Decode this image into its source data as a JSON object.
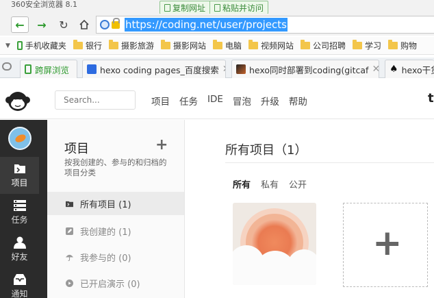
{
  "window": {
    "title": "360安全浏览器 8.1"
  },
  "clipboard": {
    "copy_url": "复制网址",
    "paste_visit": "粘贴并访问"
  },
  "address": {
    "url": "https://coding.net/user/projects"
  },
  "bookmarks": [
    {
      "label": "手机收藏夹",
      "icon": "phone-icon"
    },
    {
      "label": "银行",
      "icon": "folder-icon"
    },
    {
      "label": "摄影旅游",
      "icon": "folder-icon"
    },
    {
      "label": "摄影网站",
      "icon": "folder-icon"
    },
    {
      "label": "电脑",
      "icon": "folder-icon"
    },
    {
      "label": "视频网站",
      "icon": "folder-icon"
    },
    {
      "label": "公司招聘",
      "icon": "folder-icon"
    },
    {
      "label": "学习",
      "icon": "folder-icon"
    },
    {
      "label": "购物",
      "icon": "folder-icon"
    }
  ],
  "tabs": [
    {
      "label": "跨屏浏览"
    },
    {
      "label": "hexo coding pages_百度搜索"
    },
    {
      "label": "hexo同时部署到coding(gitcaf"
    },
    {
      "label": "hexo干货"
    }
  ],
  "app": {
    "search_placeholder": "Search...",
    "nav": [
      "项目",
      "任务",
      "IDE",
      "冒泡",
      "升级",
      "帮助"
    ],
    "right_fragment": "tı",
    "sidebar": [
      {
        "label": "项目",
        "icon": "project-icon",
        "active": true
      },
      {
        "label": "任务",
        "icon": "task-icon",
        "active": false
      },
      {
        "label": "好友",
        "icon": "friend-icon",
        "active": false
      },
      {
        "label": "通知",
        "icon": "notification-icon",
        "active": false
      }
    ],
    "panel": {
      "title": "项目",
      "add": "+",
      "desc": "按我创建的、参与的和归档的项目分类",
      "items": [
        {
          "label": "所有项目 (1)",
          "active": true
        },
        {
          "label": "我创建的 (1)",
          "active": false
        },
        {
          "label": "我参与的 (0)",
          "active": false
        },
        {
          "label": "已开启演示 (0)",
          "active": false
        }
      ]
    },
    "main": {
      "title": "所有项目（1）",
      "filters": [
        "所有",
        "私有",
        "公开"
      ],
      "new_symbol": "+"
    }
  }
}
